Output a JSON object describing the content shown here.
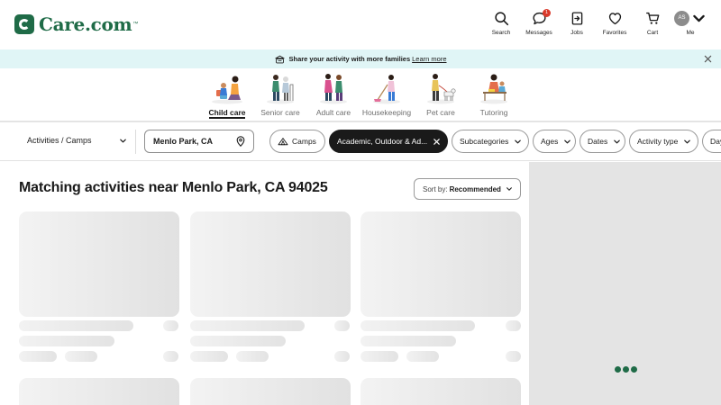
{
  "brand": {
    "name": "Care.com",
    "tm": "™",
    "color": "#1f6b47"
  },
  "nav": [
    {
      "label": "Search",
      "icon": "search-icon"
    },
    {
      "label": "Messages",
      "icon": "message-icon",
      "badge": "1"
    },
    {
      "label": "Jobs",
      "icon": "jobs-icon"
    },
    {
      "label": "Favorites",
      "icon": "heart-icon"
    },
    {
      "label": "Cart",
      "icon": "cart-icon"
    },
    {
      "label": "Me",
      "icon": "avatar",
      "initials": "AS"
    }
  ],
  "banner": {
    "text": "Share your activity with more families",
    "link": "Learn more",
    "background": "#e0f5f6"
  },
  "categories": [
    {
      "label": "Child care",
      "active": true
    },
    {
      "label": "Senior care",
      "active": false
    },
    {
      "label": "Adult care",
      "active": false
    },
    {
      "label": "Housekeeping",
      "active": false
    },
    {
      "label": "Pet care",
      "active": false
    },
    {
      "label": "Tutoring",
      "active": false
    }
  ],
  "filters": {
    "type_value": "Activities / Camps",
    "location_value": "Menlo Park, CA",
    "chips": [
      {
        "label": "Camps",
        "icon": "tent-icon"
      },
      {
        "label": "Academic, Outdoor & Ad...",
        "selected": true
      },
      {
        "label": "Subcategories"
      },
      {
        "label": "Ages"
      },
      {
        "label": "Dates"
      },
      {
        "label": "Activity type"
      },
      {
        "label": "Day"
      }
    ]
  },
  "results": {
    "title": "Matching activities near Menlo Park, CA 94025",
    "sort_label": "Sort by:",
    "sort_value": "Recommended"
  },
  "map": {
    "loading": true,
    "loader_color": "#1f6b47"
  }
}
